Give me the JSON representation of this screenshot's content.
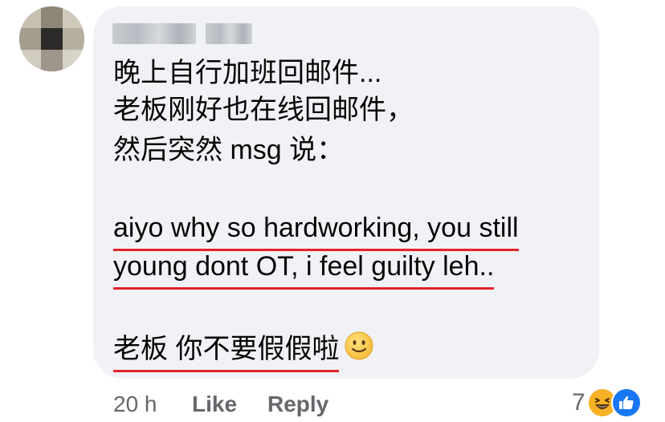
{
  "comment": {
    "lines": [
      "晚上自行加班回邮件...",
      "老板刚好也在线回邮件，",
      "然后突然 msg 说："
    ],
    "quote_lines": [
      "aiyo why so hardworking, you still",
      "young dont OT, i feel guilty leh.."
    ],
    "closing": "老板 你不要假假啦",
    "closing_emoji": "slightly-smiling-face-emoji"
  },
  "footer": {
    "time": "20 h",
    "like_label": "Like",
    "reply_label": "Reply"
  },
  "reactions": {
    "count": "7",
    "icons": [
      "haha-reaction-icon",
      "like-reaction-icon"
    ]
  },
  "colors": {
    "bubble": "#f0f2f5",
    "underline": "#e0242a",
    "meta_text": "#65676b",
    "like_blue": "#1877f2",
    "haha_yellow": "#f7b125"
  }
}
